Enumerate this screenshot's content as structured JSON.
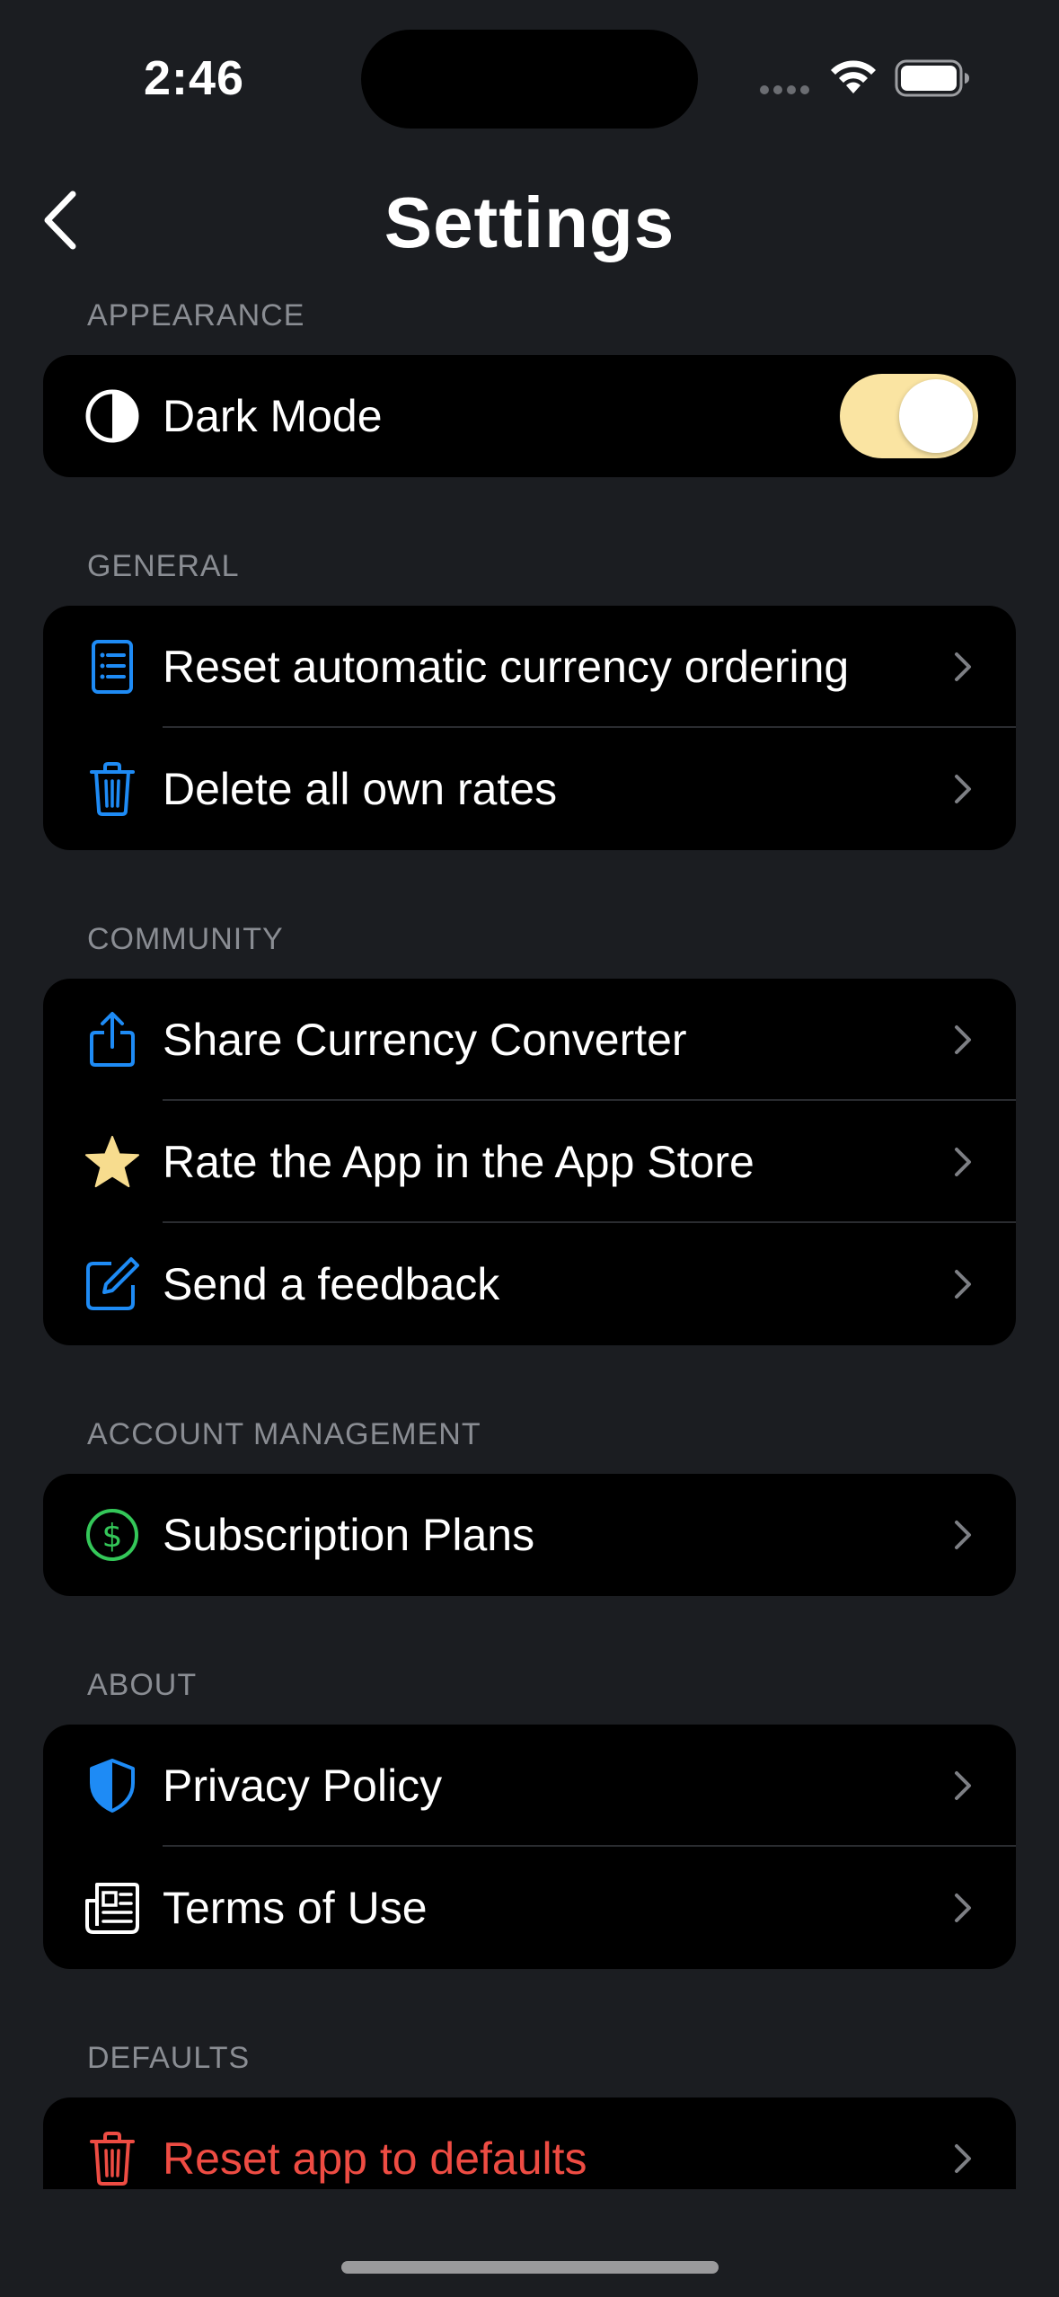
{
  "status_bar": {
    "time": "2:46"
  },
  "nav": {
    "title": "Settings"
  },
  "sections": {
    "appearance": {
      "header": "APPEARANCE",
      "items": [
        {
          "label": "Dark Mode",
          "toggle_on": true
        }
      ]
    },
    "general": {
      "header": "GENERAL",
      "items": [
        {
          "label": "Reset automatic currency ordering"
        },
        {
          "label": "Delete all own rates"
        }
      ]
    },
    "community": {
      "header": "COMMUNITY",
      "items": [
        {
          "label": "Share Currency Converter"
        },
        {
          "label": "Rate the App in the App Store"
        },
        {
          "label": "Send a feedback"
        }
      ]
    },
    "account": {
      "header": "ACCOUNT MANAGEMENT",
      "items": [
        {
          "label": "Subscription Plans"
        }
      ]
    },
    "about": {
      "header": "ABOUT",
      "items": [
        {
          "label": "Privacy Policy"
        },
        {
          "label": "Terms of Use"
        }
      ]
    },
    "defaults": {
      "header": "DEFAULTS",
      "items": [
        {
          "label": "Reset app to defaults"
        }
      ]
    }
  },
  "icons": {
    "dark_mode": "half-circle-icon",
    "reset_ordering": "list-document-icon",
    "delete_rates": "trash-icon",
    "share": "share-icon",
    "rate": "star-icon",
    "feedback": "compose-icon",
    "subscription": "dollar-circle-icon",
    "privacy": "shield-icon",
    "terms": "newspaper-icon",
    "reset_app": "trash-icon"
  },
  "colors": {
    "background": "#1b1d21",
    "card": "#000000",
    "accent_blue": "#1e8bf5",
    "toggle_on": "#fae4a2",
    "star": "#f7dc8e",
    "green": "#34c759",
    "danger": "#ee4c43",
    "section_header": "#8a8d93"
  }
}
